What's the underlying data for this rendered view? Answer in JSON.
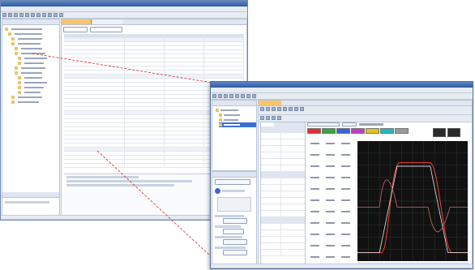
{
  "back_window": {
    "title": "",
    "menu": [
      "",
      "",
      "",
      "",
      "",
      "",
      "",
      ""
    ],
    "sidebar": {
      "header": "",
      "items": [
        "",
        "",
        "",
        "",
        "",
        "",
        "",
        "",
        "",
        "",
        "",
        "",
        "",
        "",
        "",
        ""
      ],
      "footer_header": ""
    },
    "tabs": [
      "",
      ""
    ],
    "table_headers": [
      "",
      "",
      "",
      ""
    ],
    "section_notes": [
      "",
      "",
      ""
    ],
    "status": [
      "",
      "",
      ""
    ]
  },
  "front_window": {
    "title": "",
    "menu": [
      "",
      "",
      "",
      "",
      "",
      "",
      "",
      "",
      "",
      "",
      "",
      ""
    ],
    "sidebar": {
      "project_header": "",
      "tree": [
        "",
        "",
        "",
        ""
      ],
      "assist_header": "",
      "assist_select": "",
      "steps": [
        "",
        "",
        "",
        "",
        "",
        ""
      ],
      "step_buttons": [
        "",
        "",
        "",
        ""
      ]
    },
    "graph_tab": "",
    "graph_toolbar": [
      "",
      "",
      "",
      "",
      "",
      "",
      "",
      "",
      ""
    ],
    "ch_tabs": [
      "",
      "",
      ""
    ],
    "params": [
      "",
      "",
      "",
      "",
      "",
      "",
      "",
      "",
      "",
      "",
      "",
      "",
      "",
      "",
      "",
      "",
      "",
      "",
      "",
      ""
    ],
    "channel_colors": [
      "#e03030",
      "#35a835",
      "#3a64d6",
      "#c040c0",
      "#e0c020",
      "#20b8c0",
      "#9a9a9a"
    ],
    "status": ""
  },
  "colors": {
    "graph_bg": "#111111",
    "grid": "#2d3a2d",
    "trace_1": "#ff3b3b",
    "trace_2": "#e8e8e8",
    "trace_3": "#c86a6a"
  }
}
